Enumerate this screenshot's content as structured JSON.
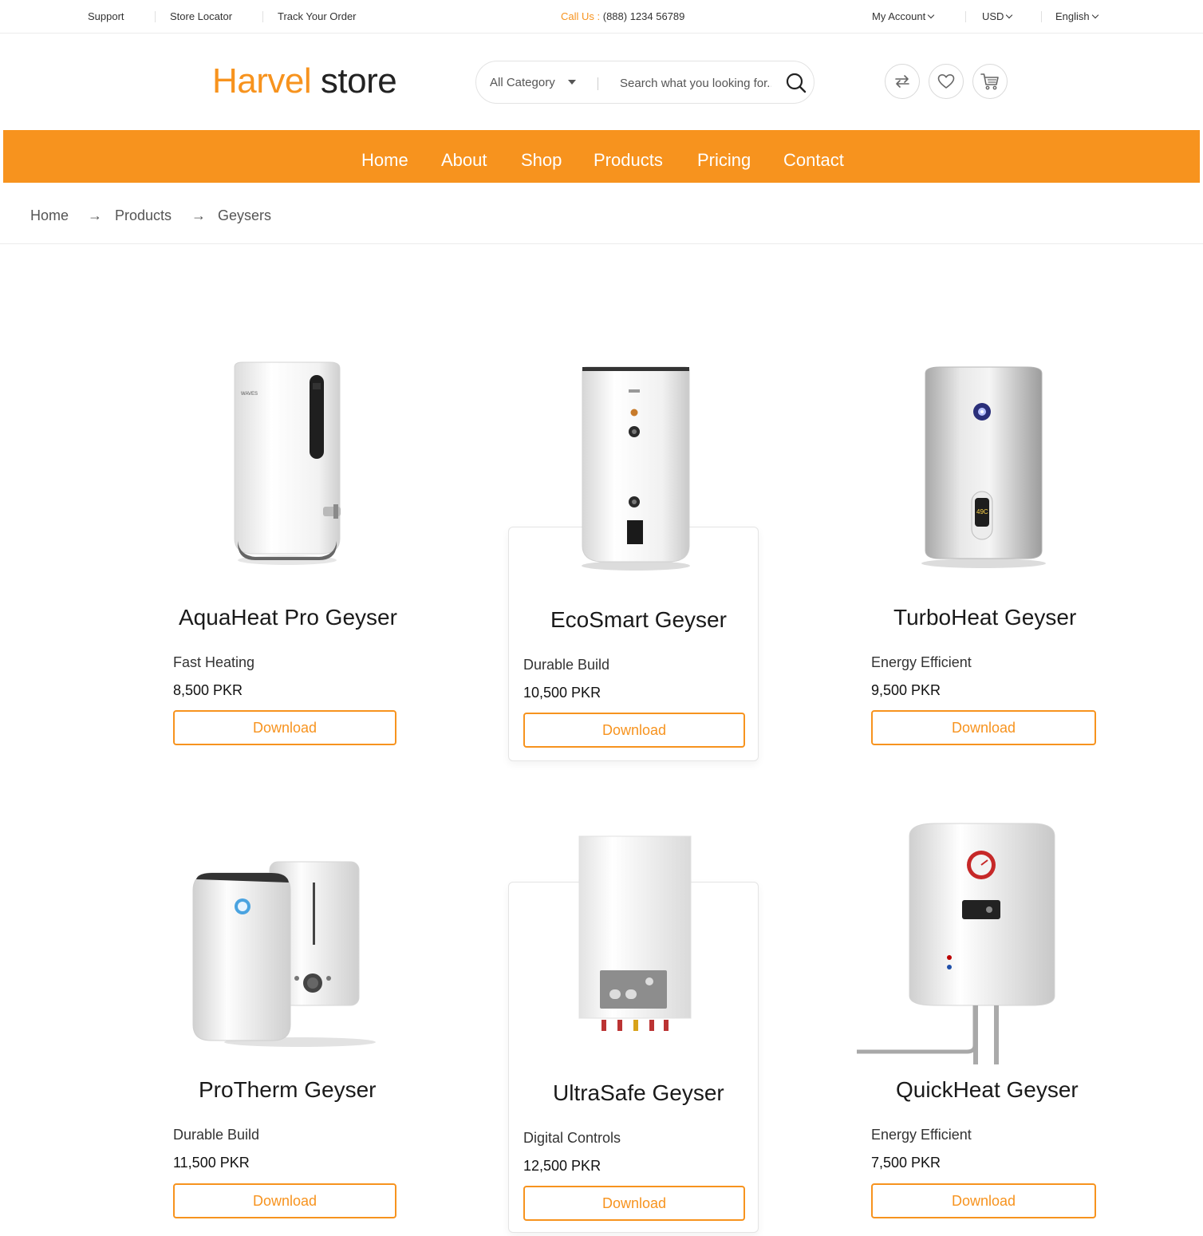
{
  "topbar": {
    "links": [
      "Support",
      "Store Locator",
      "Track Your Order"
    ],
    "call_label": "Call Us :",
    "call_number": " (888) 1234 56789",
    "account": "My Account",
    "currency": "USD",
    "language": "English"
  },
  "header": {
    "logo_brand": "Harvel",
    "logo_suffix": "store",
    "category": "All Category",
    "search_placeholder": "Search what you looking for..."
  },
  "nav": [
    "Home",
    "About",
    "Shop",
    "Products",
    "Pricing",
    "Contact"
  ],
  "breadcrumb": [
    "Home",
    "Products",
    "Geysers"
  ],
  "breadcrumb_arrow": "→",
  "products": [
    {
      "name": "AquaHeat Pro Geyser",
      "feature": "Fast Heating",
      "price": "8,500 PKR",
      "button": "Download"
    },
    {
      "name": "EcoSmart Geyser",
      "feature": "Durable Build",
      "price": "10,500 PKR",
      "button": "Download"
    },
    {
      "name": "TurboHeat Geyser",
      "feature": "Energy Efficient",
      "price": "9,500 PKR",
      "button": "Download"
    },
    {
      "name": "ProTherm Geyser",
      "feature": "Durable Build",
      "price": "11,500 PKR",
      "button": "Download"
    },
    {
      "name": "UltraSafe Geyser",
      "feature": "Digital Controls",
      "price": "12,500 PKR",
      "button": "Download"
    },
    {
      "name": "QuickHeat Geyser",
      "feature": "Energy Efficient",
      "price": "7,500 PKR",
      "button": "Download"
    }
  ],
  "colors": {
    "accent": "#f7931e",
    "text": "#222222",
    "border": "#e4e4e4"
  }
}
